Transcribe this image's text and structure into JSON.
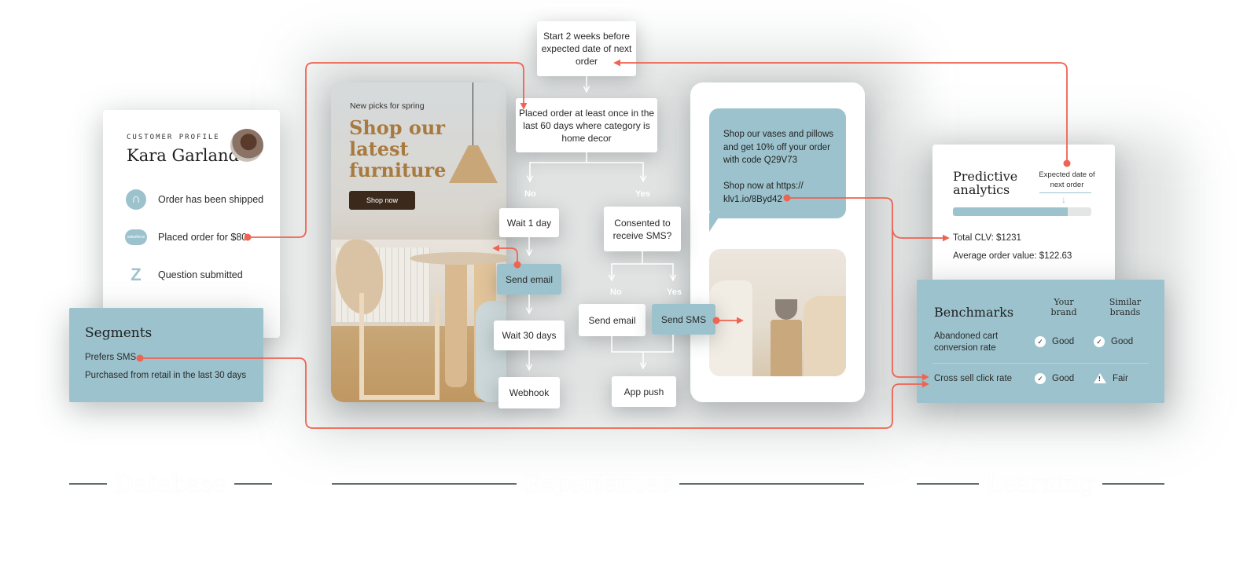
{
  "profile": {
    "kicker": "CUSTOMER PROFILE",
    "name": "Kara Garland",
    "avatar_icon": "avatar-photo",
    "events": [
      {
        "icon": "arrow-circle-icon",
        "label": "Order has been shipped"
      },
      {
        "icon": "salesforce-icon",
        "icon_text": "salesforce",
        "label": "Placed order for $80"
      },
      {
        "icon": "zendesk-icon",
        "label": "Question submitted"
      }
    ]
  },
  "segments": {
    "title": "Segments",
    "items": [
      "Prefers SMS",
      "Purchased from retail in the last 30 days"
    ]
  },
  "email": {
    "kicker": "New picks for spring",
    "headline": "Shop our latest furniture",
    "button": "Shop now"
  },
  "flow": {
    "start": "Start 2 weeks before expected date of next order",
    "condition": "Placed order at least once in the last 60 days where category is home decor",
    "branch_no": "No",
    "branch_yes": "Yes",
    "no_path": [
      "Wait 1 day",
      "Send email",
      "Wait 30 days",
      "Webhook"
    ],
    "sms_condition": "Consented to receive SMS?",
    "sms_no": "No",
    "sms_yes": "Yes",
    "sms_no_action": "Send email",
    "sms_yes_action": "Send SMS",
    "merge_action": "App push"
  },
  "sms": {
    "message": "Shop our vases and pillows and get 10% off your order with code Q29V73\n\nShop now at https:// klv1.io/8Byd42"
  },
  "predictive": {
    "title": "Predictive analytics",
    "expected_label": "Expected date of next order",
    "progress_fraction": 0.83,
    "total_clv": "Total CLV: $1231",
    "aov": "Average order value: $122.63"
  },
  "benchmarks": {
    "title": "Benchmarks",
    "col_your": "Your brand",
    "col_similar": "Similar brands",
    "rows": [
      {
        "metric": "Abandoned cart conversion rate",
        "your": "Good",
        "your_status": "check",
        "similar": "Good",
        "similar_status": "check"
      },
      {
        "metric": "Cross sell click rate",
        "your": "Good",
        "your_status": "check",
        "similar": "Fair",
        "similar_status": "warning"
      }
    ]
  },
  "sections": [
    "Database",
    "Experiences",
    "Learning"
  ],
  "colors": {
    "accent_teal": "#9cc3cd",
    "connector_red": "#ee6352",
    "headline_brown": "#a97a3f",
    "button_dark": "#3b2a1c"
  }
}
